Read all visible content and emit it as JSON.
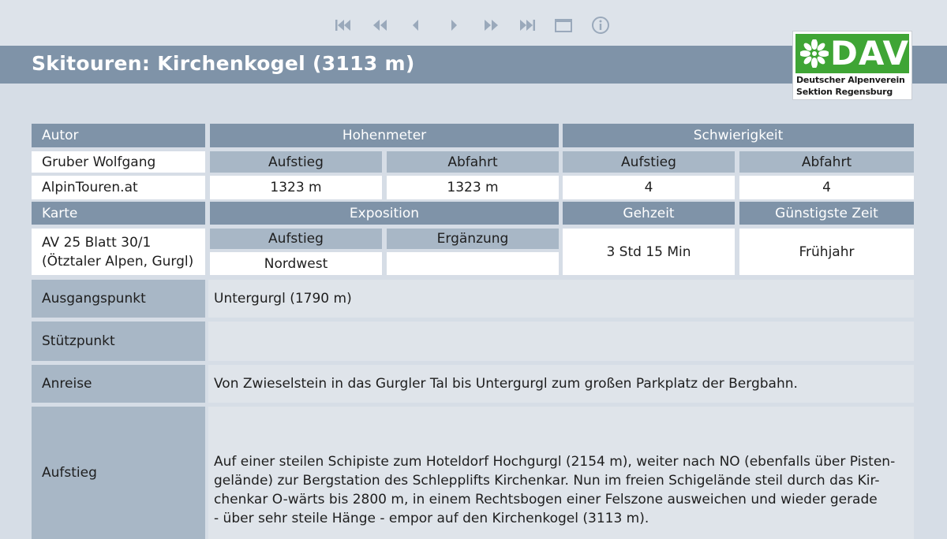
{
  "toolbar": {
    "buttons": [
      {
        "name": "first-page-button",
        "icon": "skip-first-icon"
      },
      {
        "name": "rewind-button",
        "icon": "rewind-icon"
      },
      {
        "name": "previous-button",
        "icon": "previous-icon"
      },
      {
        "name": "next-button",
        "icon": "next-icon"
      },
      {
        "name": "fast-forward-button",
        "icon": "fast-forward-icon"
      },
      {
        "name": "last-page-button",
        "icon": "skip-last-icon"
      },
      {
        "name": "window-button",
        "icon": "window-icon"
      },
      {
        "name": "info-button",
        "icon": "info-icon"
      }
    ],
    "icon_color": "#9aa9bb"
  },
  "header": {
    "title": "Skitouren:  Kirchenkogel (3113 m)",
    "background": "#7f93a8"
  },
  "logo": {
    "brand": "DAV",
    "line1": "Deutscher Alpenverein",
    "line2": "Sektion Regensburg",
    "color": "#3fa535"
  },
  "table": {
    "autor_label": "Autor",
    "autor_name": "Gruber Wolfgang",
    "autor_site": "AlpinTouren.at",
    "hoehenmeter_label": "Hohenmeter",
    "hoehenmeter_aufstieg_label": "Aufstieg",
    "hoehenmeter_abfahrt_label": "Abfahrt",
    "hoehenmeter_aufstieg": "1323 m",
    "hoehenmeter_abfahrt": "1323 m",
    "schwierigkeit_label": "Schwierigkeit",
    "schwierigkeit_aufstieg_label": "Aufstieg",
    "schwierigkeit_abfahrt_label": "Abfahrt",
    "schwierigkeit_aufstieg": "4",
    "schwierigkeit_abfahrt": "4",
    "karte_label": "Karte",
    "karte_value": "AV 25 Blatt 30/1\n(Ötztaler Alpen, Gurgl)",
    "exposition_label": "Exposition",
    "exposition_aufstieg_label": "Aufstieg",
    "exposition_ergaenzung_label": "Ergänzung",
    "exposition_aufstieg": "Nordwest",
    "exposition_ergaenzung": "",
    "gehzeit_label": "Gehzeit",
    "gehzeit_value": "3 Std 15 Min",
    "zeit_label": "Günstigste Zeit",
    "zeit_value": "Frühjahr"
  },
  "details": {
    "ausgangspunkt_label": "Ausgangspunkt",
    "ausgangspunkt_value": "Untergurgl (1790 m)",
    "stuetzpunkt_label": "Stützpunkt",
    "stuetzpunkt_value": "",
    "anreise_label": "Anreise",
    "anreise_value": "Von Zwieselstein in das Gurgler Tal bis Untergurgl zum großen Parkplatz der Bergbahn.",
    "aufstieg_label": "Aufstieg",
    "aufstieg_value": "Auf einer steilen Schipiste zum Hoteldorf Hochgurgl (2154 m), weiter nach NO (ebenfalls über Pisten-\ngelände) zur Bergstation des Schlepplifts Kirchenkar. Nun im freien Schigelände steil durch das Kir-\nchenkar O-wärts bis 2800 m, in einem Rechtsbogen einer Felszone ausweichen und wieder gerade\n- über sehr steile Hänge - empor auf den Kirchenkogel (3113 m)."
  }
}
